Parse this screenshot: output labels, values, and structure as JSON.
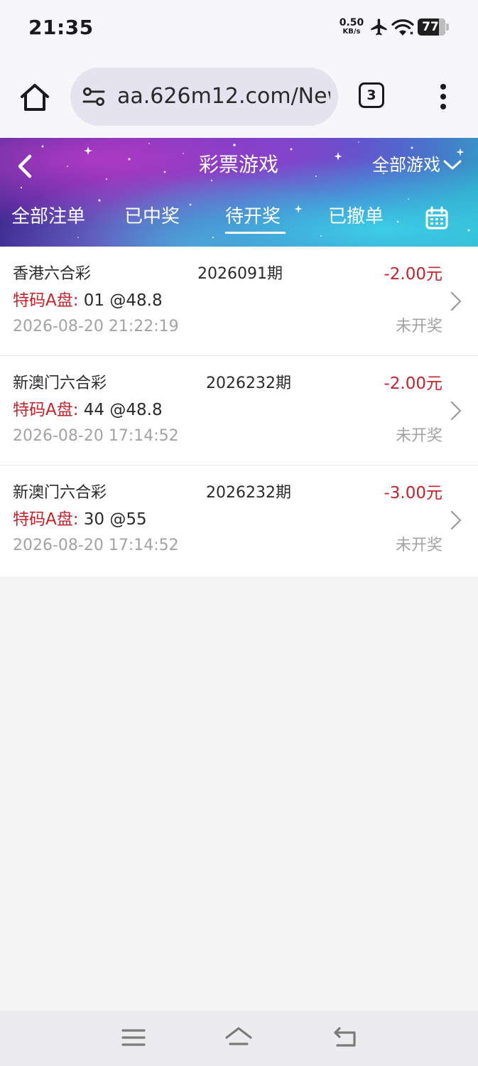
{
  "status_bar": {
    "time": "21:35",
    "net_speed_value": "0.50",
    "net_speed_unit": "KB/s",
    "icons": [
      "airplane-mode-icon",
      "wifi-icon"
    ],
    "battery_level": "77"
  },
  "browser": {
    "url": "aa.626m12.com/New",
    "tab_count": "3",
    "icons": [
      "home-icon",
      "site-info-icon",
      "more-vert-icon"
    ]
  },
  "header": {
    "title": "彩票游戏",
    "filter_label": "全部游戏",
    "tabs": [
      {
        "label": "全部注单",
        "active": false
      },
      {
        "label": "已中奖",
        "active": false
      },
      {
        "label": "待开奖",
        "active": true
      },
      {
        "label": "已撤单",
        "active": false
      }
    ]
  },
  "bets": [
    {
      "game": "香港六合彩",
      "period": "2026091期",
      "amount": "-2.00元",
      "bet_type": "特码A盘:",
      "pick": " 01 @48.8",
      "time": "2026-08-20 21:22:19",
      "status": "未开奖"
    },
    {
      "game": "新澳门六合彩",
      "period": "2026232期",
      "amount": "-2.00元",
      "bet_type": "特码A盘:",
      "pick": " 44 @48.8",
      "time": "2026-08-20 17:14:52",
      "status": "未开奖"
    },
    {
      "game": "新澳门六合彩",
      "period": "2026232期",
      "amount": "-3.00元",
      "bet_type": "特码A盘:",
      "pick": " 30 @55",
      "time": "2026-08-20 17:14:52",
      "status": "未开奖"
    }
  ],
  "colors": {
    "accent_red": "#c8222a",
    "muted_text": "#a3a3a3",
    "page_bg": "#f4f4f5"
  }
}
